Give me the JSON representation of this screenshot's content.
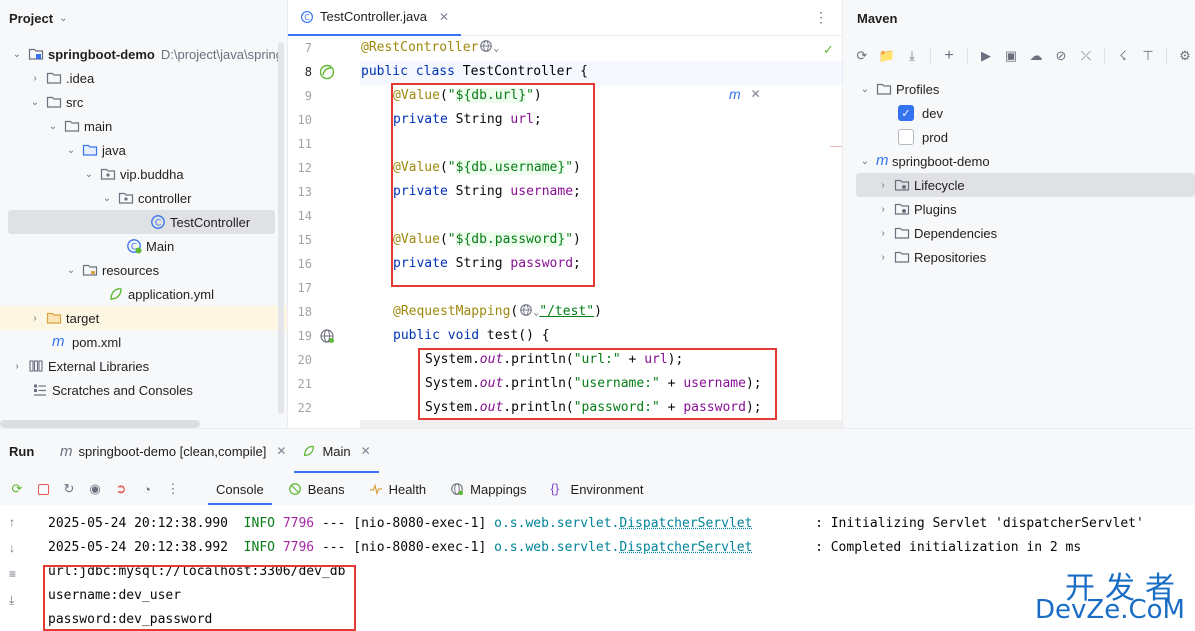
{
  "project": {
    "title": "Project",
    "tree": [
      {
        "label": "springboot-demo",
        "note": "D:\\project\\java\\spring"
      },
      {
        "label": ".idea"
      },
      {
        "label": "src"
      },
      {
        "label": "main"
      },
      {
        "label": "java"
      },
      {
        "label": "vip.buddha"
      },
      {
        "label": "controller"
      },
      {
        "label": "TestController"
      },
      {
        "label": "Main"
      },
      {
        "label": "resources"
      },
      {
        "label": "application.yml"
      },
      {
        "label": "target"
      },
      {
        "label": "pom.xml"
      },
      {
        "label": "External Libraries"
      },
      {
        "label": "Scratches and Consoles"
      }
    ]
  },
  "editor": {
    "tab_label": "TestController.java",
    "line_numbers": [
      "7",
      "8",
      "9",
      "10",
      "11",
      "12",
      "13",
      "14",
      "15",
      "16",
      "17",
      "18",
      "19",
      "20",
      "21",
      "22"
    ],
    "code": {
      "l7_ann": "@RestController",
      "l8_kw1": "public",
      "l8_kw2": "class",
      "l8_name": " TestController ",
      "l8_brace": "{",
      "l9_ann": "@Value",
      "l9_p1": "(",
      "l9_q1": "\"",
      "l9_ph": "${db.url}",
      "l9_q2": "\"",
      "l9_p2": ")",
      "l10_kw": "private",
      "l10_type": " String ",
      "l10_fld": "url",
      "l10_end": ";",
      "l12_ann": "@Value",
      "l12_p1": "(",
      "l12_q1": "\"",
      "l12_ph": "${db.username}",
      "l12_q2": "\"",
      "l12_p2": ")",
      "l13_kw": "private",
      "l13_type": " String ",
      "l13_fld": "username",
      "l13_end": ";",
      "l15_ann": "@Value",
      "l15_p1": "(",
      "l15_q1": "\"",
      "l15_ph": "${db.password}",
      "l15_q2": "\"",
      "l15_p2": ")",
      "l16_kw": "private",
      "l16_type": " String ",
      "l16_fld": "password",
      "l16_end": ";",
      "l18_ann": "@RequestMapping",
      "l18_p1": "(",
      "l18_str": "\"/test\"",
      "l18_p2": ")",
      "l19_kw1": "public",
      "l19_kw2": "void",
      "l19_rest": " test() {",
      "l20_a": "System.",
      "l20_out": "out",
      "l20_b": ".println(",
      "l20_str": "\"url:\"",
      "l20_c": " + ",
      "l20_fld": "url",
      "l20_d": ");",
      "l21_a": "System.",
      "l21_out": "out",
      "l21_b": ".println(",
      "l21_str": "\"username:\"",
      "l21_c": " + ",
      "l21_fld": "username",
      "l21_d": ");",
      "l22_a": "System.",
      "l22_out": "out",
      "l22_b": ".println(",
      "l22_str": "\"password:\"",
      "l22_c": " + ",
      "l22_fld": "password",
      "l22_d": ");",
      "l23": "}"
    }
  },
  "maven": {
    "title": "Maven",
    "tree": [
      {
        "label": "Profiles"
      },
      {
        "label": "dev",
        "checked": true
      },
      {
        "label": "prod",
        "checked": false
      },
      {
        "label": "springboot-demo"
      },
      {
        "label": "Lifecycle"
      },
      {
        "label": "Plugins"
      },
      {
        "label": "Dependencies"
      },
      {
        "label": "Repositories"
      }
    ]
  },
  "run": {
    "title": "Run",
    "tabs": [
      {
        "label": "springboot-demo [clean,compile]"
      },
      {
        "label": "Main"
      }
    ],
    "console_tabs": [
      "Console",
      "Beans",
      "Health",
      "Mappings",
      "Environment"
    ],
    "log_lines": [
      {
        "date": "2025-05-24 20:12:38.990",
        "level": "INFO",
        "pid": "7796",
        "sep": "---",
        "thread": "[nio-8080-exec-1]",
        "pkg": "o.s.web.servlet.",
        "cls": "DispatcherServlet",
        "msg": ": Initializing Servlet 'dispatcherServlet'"
      },
      {
        "date": "2025-05-24 20:12:38.992",
        "level": "INFO",
        "pid": "7796",
        "sep": "---",
        "thread": "[nio-8080-exec-1]",
        "pkg": "o.s.web.servlet.",
        "cls": "DispatcherServlet",
        "msg": ": Completed initialization in 2 ms"
      }
    ],
    "output_lines": [
      "url:jdbc:mysql://localhost:3306/dev_db",
      "username:dev_user",
      "password:dev_password"
    ]
  },
  "watermark": {
    "cn": "开发者",
    "en": "DevZe.CoM"
  },
  "colors": {
    "accent": "#3574f0",
    "highlight_box": "#e53935",
    "watermark": "#1a6dc4"
  }
}
